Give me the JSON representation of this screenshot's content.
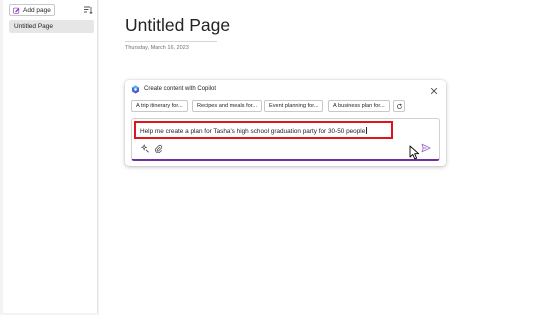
{
  "sidebar": {
    "add_page_label": "Add page",
    "pages": [
      {
        "label": "Untitled Page",
        "selected": true
      }
    ]
  },
  "page": {
    "title": "Untitled Page",
    "date": "Thursday, March 16, 2023"
  },
  "copilot": {
    "header": "Create content with Copilot",
    "chips": [
      "A trip itinerary for...",
      "Recipes and meals for...",
      "Event planning for...",
      "A business plan for..."
    ],
    "prompt_value": "Help me create a plan for Tasha's high school graduation party for 30-50 people"
  },
  "colors": {
    "accent": "#6b2fa8",
    "highlight": "#e0141c",
    "add_page_icon": "#8a3ab9"
  },
  "icons": [
    "add-page-icon",
    "sort-icon",
    "copilot-logo-icon",
    "close-icon",
    "refresh-icon",
    "sparkle-icon",
    "attach-icon",
    "send-icon",
    "mouse-cursor-icon"
  ]
}
